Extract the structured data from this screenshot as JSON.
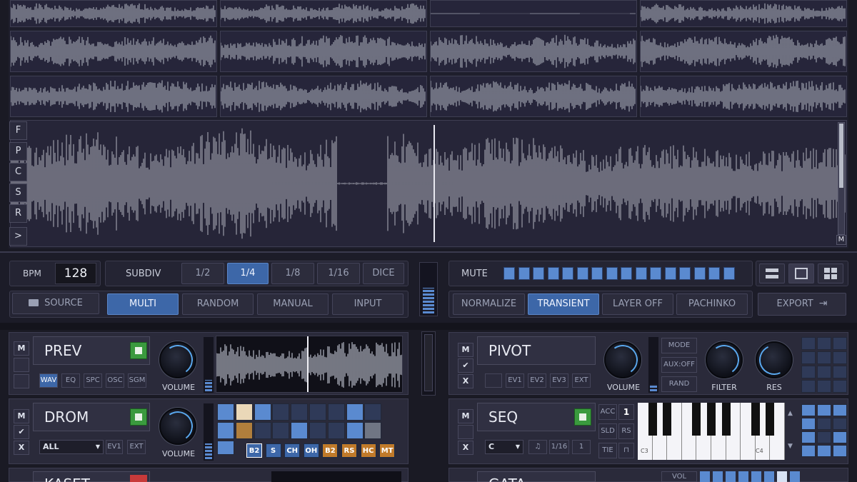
{
  "side_buttons": [
    "F",
    "P",
    "C",
    "S",
    "R",
    ">"
  ],
  "main_wave_corner": "M",
  "controls": {
    "bpm_label": "BPM",
    "bpm_value": "128",
    "subdiv_label": "SUBDIV",
    "subdiv_options": [
      "1/2",
      "1/4",
      "1/8",
      "1/16",
      "DICE"
    ],
    "subdiv_selected": "1/4",
    "source_label": "SOURCE",
    "modes": [
      "MULTI",
      "RANDOM",
      "MANUAL",
      "INPUT"
    ],
    "mode_selected": "MULTI",
    "mute_label": "MUTE",
    "mute_steps": 16,
    "process": [
      "NORMALIZE",
      "TRANSIENT",
      "LAYER OFF",
      "PACHINKO"
    ],
    "process_selected": "TRANSIENT",
    "export_label": "EXPORT"
  },
  "modules": {
    "prev": {
      "title": "PREV",
      "tabs": [
        "WAV",
        "EQ",
        "SPC",
        "OSC",
        "SGM"
      ],
      "tab_selected": "WAV",
      "knob_label": "VOLUME"
    },
    "drom": {
      "title": "DROM",
      "select_value": "ALL",
      "buttons": [
        "EV1",
        "EXT"
      ],
      "knob_label": "VOLUME",
      "pads": [
        {
          "label": "B2",
          "color": "#3d67a8"
        },
        {
          "label": "S",
          "color": "#3d67a8"
        },
        {
          "label": "CH",
          "color": "#3d67a8"
        },
        {
          "label": "OH",
          "color": "#3d67a8"
        },
        {
          "label": "B2",
          "color": "#c07a2a"
        },
        {
          "label": "RS",
          "color": "#c07a2a"
        },
        {
          "label": "HC",
          "color": "#c07a2a"
        },
        {
          "label": "MT",
          "color": "#c07a2a"
        }
      ]
    },
    "kaset": {
      "title": "KASET"
    },
    "pivot": {
      "title": "PIVOT",
      "buttons": [
        "EV1",
        "EV2",
        "EV3",
        "EXT"
      ],
      "knob_label": "VOLUME",
      "side_buttons": [
        "MODE",
        "AUX:OFF",
        "RAND"
      ],
      "filter_label": "FILTER",
      "res_label": "RES"
    },
    "seq": {
      "title": "SEQ",
      "acc_label": "ACC",
      "acc_value": "1",
      "sld_label": "SLD",
      "rs_label": "RS",
      "tie_label": "TIE",
      "key_value": "C",
      "rate_value": "1/16",
      "step_value": "1",
      "key_c3": "C3",
      "key_c4": "C4"
    },
    "gata": {
      "title": "GATA",
      "vol_label": "VOL"
    }
  },
  "module_toggles": {
    "m": "M",
    "x": "X"
  }
}
